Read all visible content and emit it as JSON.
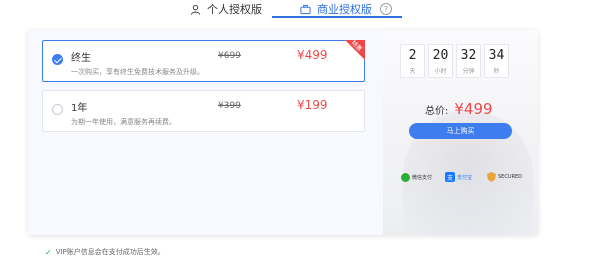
{
  "tabs": [
    {
      "label": "个人授权版",
      "icon": "user-icon"
    },
    {
      "label": "商业授权版",
      "icon": "briefcase-icon"
    }
  ],
  "help_symbol": "?",
  "plans": [
    {
      "name": "终生",
      "description": "一次购买，享有终生免费技术服务及升级。",
      "original_price": "¥699",
      "price": "¥499",
      "selected": true,
      "badge": "特惠"
    },
    {
      "name": "1年",
      "description": "为期一年使用，满意服务再续费。",
      "original_price": "¥399",
      "price": "¥199",
      "selected": false
    }
  ],
  "countdown": [
    {
      "value": "2",
      "unit": "天"
    },
    {
      "value": "20",
      "unit": "小时"
    },
    {
      "value": "32",
      "unit": "分钟"
    },
    {
      "value": "34",
      "unit": "秒"
    }
  ],
  "total": {
    "label": "总价:",
    "value": "¥499"
  },
  "buy_button": "马上购买",
  "payments": [
    {
      "name": "微信支付",
      "icon": "wechat-pay-icon"
    },
    {
      "name": "支付宝",
      "icon": "alipay-icon"
    },
    {
      "name": "SECURED",
      "icon": "secure-shield-icon"
    }
  ],
  "note": "VIP账户信息会在支付成功后生效。",
  "colors": {
    "accent": "#3d7df0",
    "price": "#f04848",
    "success": "#2bad3a"
  }
}
